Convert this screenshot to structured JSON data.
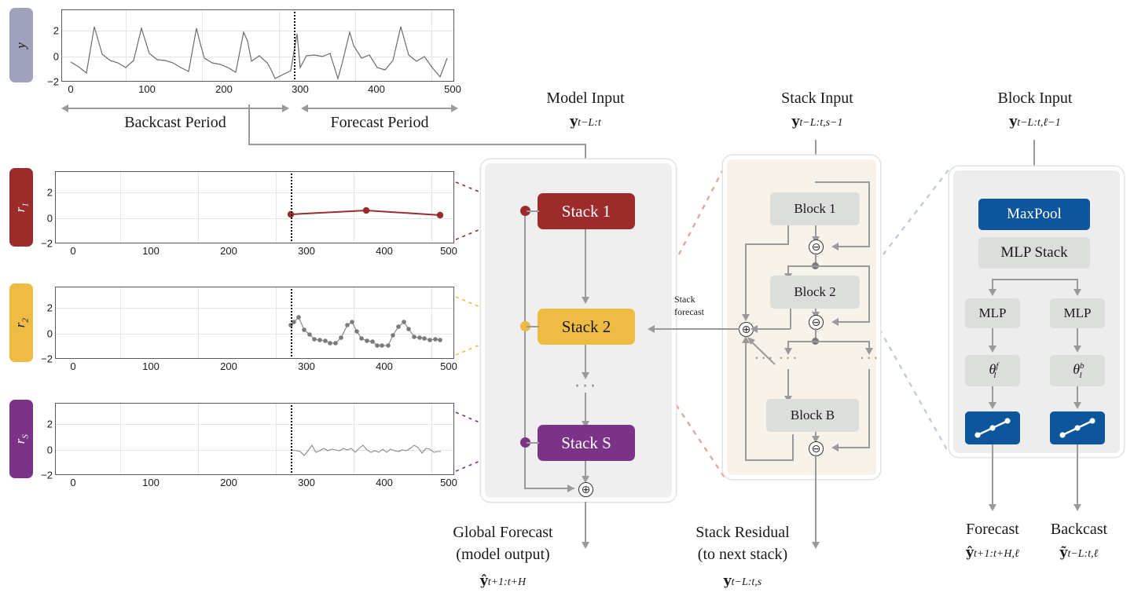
{
  "figure": {
    "title": "N-BEATS style hierarchical forecasting architecture diagram"
  },
  "top_series": {
    "ylabel": "y",
    "badge_color": "#a0a2bd",
    "backcast_label": "Backcast Period",
    "forecast_label": "Forecast Period",
    "yticks": [
      "2",
      "0",
      "−2"
    ],
    "xticks": [
      "0",
      "100",
      "200",
      "300",
      "400",
      "500"
    ],
    "split_x": 288
  },
  "residual_panels": [
    {
      "ylabel": "r",
      "sub": "1",
      "color": "#9c2b2b",
      "yticks": [
        "2",
        "0",
        "−2"
      ],
      "xticks": [
        "0",
        "100",
        "200",
        "300",
        "400",
        "500"
      ],
      "split_x": 288
    },
    {
      "ylabel": "r",
      "sub": "2",
      "color": "#eebb44",
      "yticks": [
        "2",
        "0",
        "−2"
      ],
      "xticks": [
        "0",
        "100",
        "200",
        "300",
        "400",
        "500"
      ],
      "split_x": 288
    },
    {
      "ylabel": "r",
      "sub": "S",
      "color": "#7b3388",
      "yticks": [
        "2",
        "0",
        "−2"
      ],
      "xticks": [
        "0",
        "100",
        "200",
        "300",
        "400",
        "500"
      ],
      "split_x": 288
    }
  ],
  "model_column": {
    "header": "Model Input",
    "header_math_y": "y",
    "header_math_sub": "t−L:t",
    "stacks": [
      {
        "label": "Stack 1",
        "color": "#9c2b2b",
        "text_color": "#ffffff"
      },
      {
        "label": "Stack 2",
        "color": "#eebb44",
        "text_color": "#1a1a1a"
      },
      {
        "label": "Stack S",
        "color": "#7b3388",
        "text_color": "#ffffff"
      }
    ],
    "ellipsis": "···",
    "sum_symbol": "⊕",
    "footer_line1": "Global Forecast",
    "footer_line2": "(model output)",
    "footer_math_y": "ŷ",
    "footer_math_sub": "t+1:t+H"
  },
  "stack_column": {
    "header": "Stack Input",
    "header_math_y": "y",
    "header_math_sub": "t−L:t,s−1",
    "stack_forecast_label_line1": "Stack",
    "stack_forecast_label_line2": "forecast",
    "blocks": [
      {
        "label": "Block 1"
      },
      {
        "label": "Block 2"
      },
      {
        "label": "Block B"
      }
    ],
    "ellipsis": "···",
    "minus_symbol": "⊖",
    "plus_symbol": "⊕",
    "container_color": "#f7f2ea",
    "block_color": "#dcdedc",
    "footer_line1": "Stack Residual",
    "footer_line2": "(to next stack)",
    "footer_math_y": "y",
    "footer_math_sub": "t−L:t,s"
  },
  "block_column": {
    "header": "Block Input",
    "header_math_y": "y",
    "header_math_sub": "t−L:t,ℓ−1",
    "maxpool_label": "MaxPool",
    "maxpool_color": "#0e569c",
    "mlp_stack_label": "MLP Stack",
    "mlp_left_label": "MLP",
    "mlp_right_label": "MLP",
    "theta_forecast": "θ",
    "theta_forecast_sup": "f",
    "theta_forecast_sub": "l",
    "theta_backcast": "θ",
    "theta_backcast_sup": "b",
    "theta_backcast_sub": "l",
    "basis_icon": "linear-basis-icon",
    "basis_color": "#0e569c",
    "node_color": "#dcdedc",
    "container_color": "#ededed",
    "footer_forecast": "Forecast",
    "footer_forecast_math_y": "ŷ",
    "footer_forecast_math_sub": "t+1:t+H,ℓ",
    "footer_backcast": "Backcast",
    "footer_backcast_math_y": "ỹ",
    "footer_backcast_math_sub": "t−L:t,ℓ"
  },
  "chart_data": {
    "type": "line",
    "title": "Hierarchical residual decomposition of a univariate time series",
    "xlabel": "",
    "ylabel": "y",
    "xlim": [
      -12,
      500
    ],
    "ylim": [
      -2.6,
      2.8
    ],
    "grid": true,
    "legend": "none",
    "split_x": 288,
    "panels": [
      {
        "name": "y",
        "ylabel": "y",
        "color": "#6b6b6b",
        "description": "Original signal, spiky quasi-periodic series spanning backcast and forecast periods",
        "x": [
          0,
          10,
          20,
          30,
          40,
          50,
          60,
          70,
          80,
          90,
          95,
          100,
          110,
          120,
          130,
          140,
          150,
          160,
          165,
          170,
          180,
          190,
          200,
          210,
          220,
          225,
          230,
          240,
          250,
          255,
          260,
          270,
          280,
          288,
          292,
          300,
          310,
          320,
          330,
          340,
          345,
          355,
          360,
          370,
          380,
          390,
          400,
          410,
          420,
          425,
          430,
          440,
          450,
          460,
          470,
          480
        ],
        "y": [
          -0.55,
          -0.95,
          -1.45,
          2.45,
          0.2,
          -0.3,
          -0.45,
          -0.95,
          -0.4,
          2.3,
          1.2,
          0.25,
          -0.2,
          -0.3,
          -0.45,
          -0.85,
          -1.15,
          2.3,
          1.0,
          -0.1,
          -0.45,
          -0.55,
          -0.85,
          -1.2,
          2.05,
          1.2,
          -0.35,
          0.05,
          -0.45,
          -1.1,
          -1.85,
          -1.55,
          -1.2,
          1.95,
          -0.85,
          0.05,
          0.1,
          -0.05,
          0.2,
          -1.85,
          -0.6,
          2.0,
          0.85,
          -0.15,
          0.1,
          -0.85,
          -1.05,
          -0.3,
          2.45,
          1.2,
          0.1,
          -0.35,
          0.0,
          -0.95,
          -1.65,
          -0.1
        ]
      },
      {
        "name": "r1",
        "ylabel": "r1",
        "color": "#9c2b2b",
        "marker": "o",
        "description": "Stack 1 residual component: near-flat trend with 3 markers in the forecast period only",
        "x": [
          288,
          385,
          480
        ],
        "y": [
          0.35,
          0.67,
          0.25
        ]
      },
      {
        "name": "r2",
        "ylabel": "r2",
        "color": "#7a7a7a",
        "marker": "o",
        "description": "Stack 2 residual component: seasonal oscillation with markers, forecast period only",
        "x": [
          288,
          292,
          298,
          305,
          312,
          318,
          325,
          332,
          338,
          345,
          352,
          360,
          366,
          372,
          378,
          385,
          392,
          398,
          404,
          412,
          418,
          425,
          432,
          438,
          445,
          452,
          458,
          465,
          472,
          478
        ],
        "y": [
          0.65,
          0.9,
          1.25,
          0.3,
          -0.05,
          -0.45,
          -0.55,
          -0.6,
          -0.75,
          -0.75,
          -0.3,
          0.65,
          0.95,
          0.2,
          -0.35,
          -0.5,
          -0.6,
          -0.9,
          -0.85,
          -0.85,
          -0.1,
          0.55,
          0.9,
          0.4,
          -0.25,
          -0.3,
          -0.35,
          -0.5,
          -0.45,
          -0.5
        ]
      },
      {
        "name": "rS",
        "ylabel": "rS",
        "color": "#8a8a8a",
        "description": "Stack S residual component: low-amplitude noise around zero, forecast period only",
        "x": [
          288,
          295,
          300,
          305,
          310,
          315,
          320,
          325,
          330,
          335,
          340,
          345,
          350,
          355,
          360,
          365,
          370,
          375,
          380,
          385,
          390,
          395,
          400,
          405,
          410,
          415,
          420,
          425,
          430,
          435,
          440,
          445,
          450,
          455,
          460,
          465,
          470,
          475,
          480
        ],
        "y": [
          0.02,
          -0.05,
          -0.12,
          -0.42,
          -0.1,
          0.35,
          -0.18,
          -0.08,
          0.12,
          -0.05,
          0.08,
          0.02,
          -0.05,
          0.1,
          -0.02,
          0.1,
          -0.22,
          0.1,
          0.38,
          0.02,
          -0.2,
          -0.05,
          -0.22,
          0.05,
          -0.18,
          0.08,
          -0.05,
          -0.12,
          0.02,
          -0.1,
          0.12,
          0.42,
          0.18,
          -0.3,
          0.1,
          0.05,
          -0.18,
          -0.1,
          -0.12
        ]
      }
    ]
  }
}
